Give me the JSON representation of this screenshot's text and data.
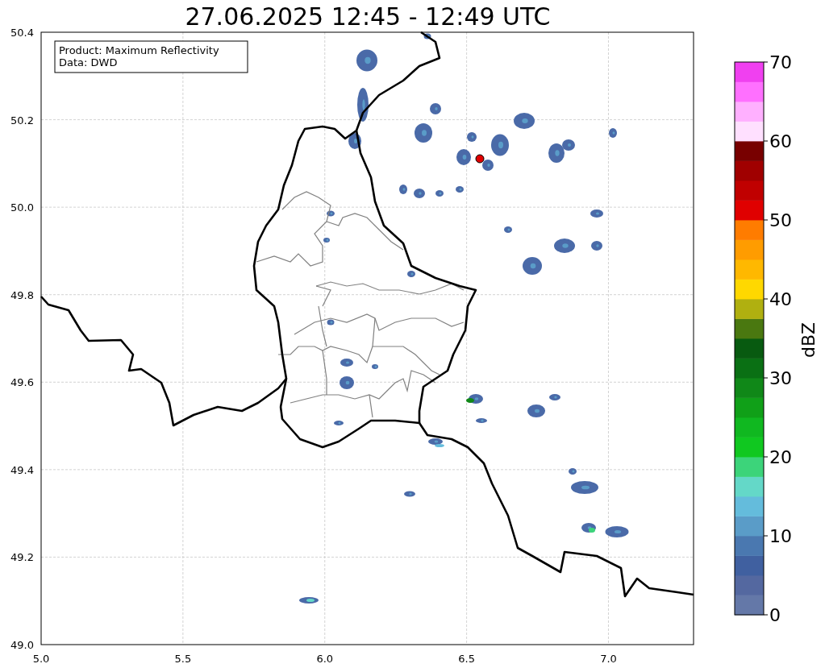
{
  "title": "27.06.2025 12:45 - 12:49 UTC",
  "info_box": [
    "Product: Maximum Reflectivity",
    "Data: DWD"
  ],
  "x_axis": {
    "ticks": [
      "5.0",
      "5.5",
      "6.0",
      "6.5",
      "7.0"
    ]
  },
  "y_axis": {
    "ticks": [
      "50.4",
      "50.2",
      "50.0",
      "49.8",
      "49.6",
      "49.4",
      "49.2",
      "49.0"
    ]
  },
  "colorbar": {
    "label": "dBZ",
    "ticks": [
      "70",
      "60",
      "50",
      "40",
      "30",
      "20",
      "10",
      "0"
    ],
    "segments": [
      {
        "color": "#6478a8"
      },
      {
        "color": "#5468a0"
      },
      {
        "color": "#4060a0"
      },
      {
        "color": "#4a78b0"
      },
      {
        "color": "#5a9cc8"
      },
      {
        "color": "#64bcdc"
      },
      {
        "color": "#64d8c8"
      },
      {
        "color": "#3cd47a"
      },
      {
        "color": "#10c820"
      },
      {
        "color": "#10b820"
      },
      {
        "color": "#10a018"
      },
      {
        "color": "#108818"
      },
      {
        "color": "#0a7014"
      },
      {
        "color": "#085a10"
      },
      {
        "color": "#4a7810"
      },
      {
        "color": "#b0b010"
      },
      {
        "color": "#ffd800"
      },
      {
        "color": "#ffb800"
      },
      {
        "color": "#ff9c00"
      },
      {
        "color": "#ff7c00"
      },
      {
        "color": "#e00000"
      },
      {
        "color": "#c00000"
      },
      {
        "color": "#a00000"
      },
      {
        "color": "#780000"
      },
      {
        "color": "#ffe0ff"
      },
      {
        "color": "#ffb0ff"
      },
      {
        "color": "#ff70ff"
      },
      {
        "color": "#f040f0"
      }
    ]
  }
}
